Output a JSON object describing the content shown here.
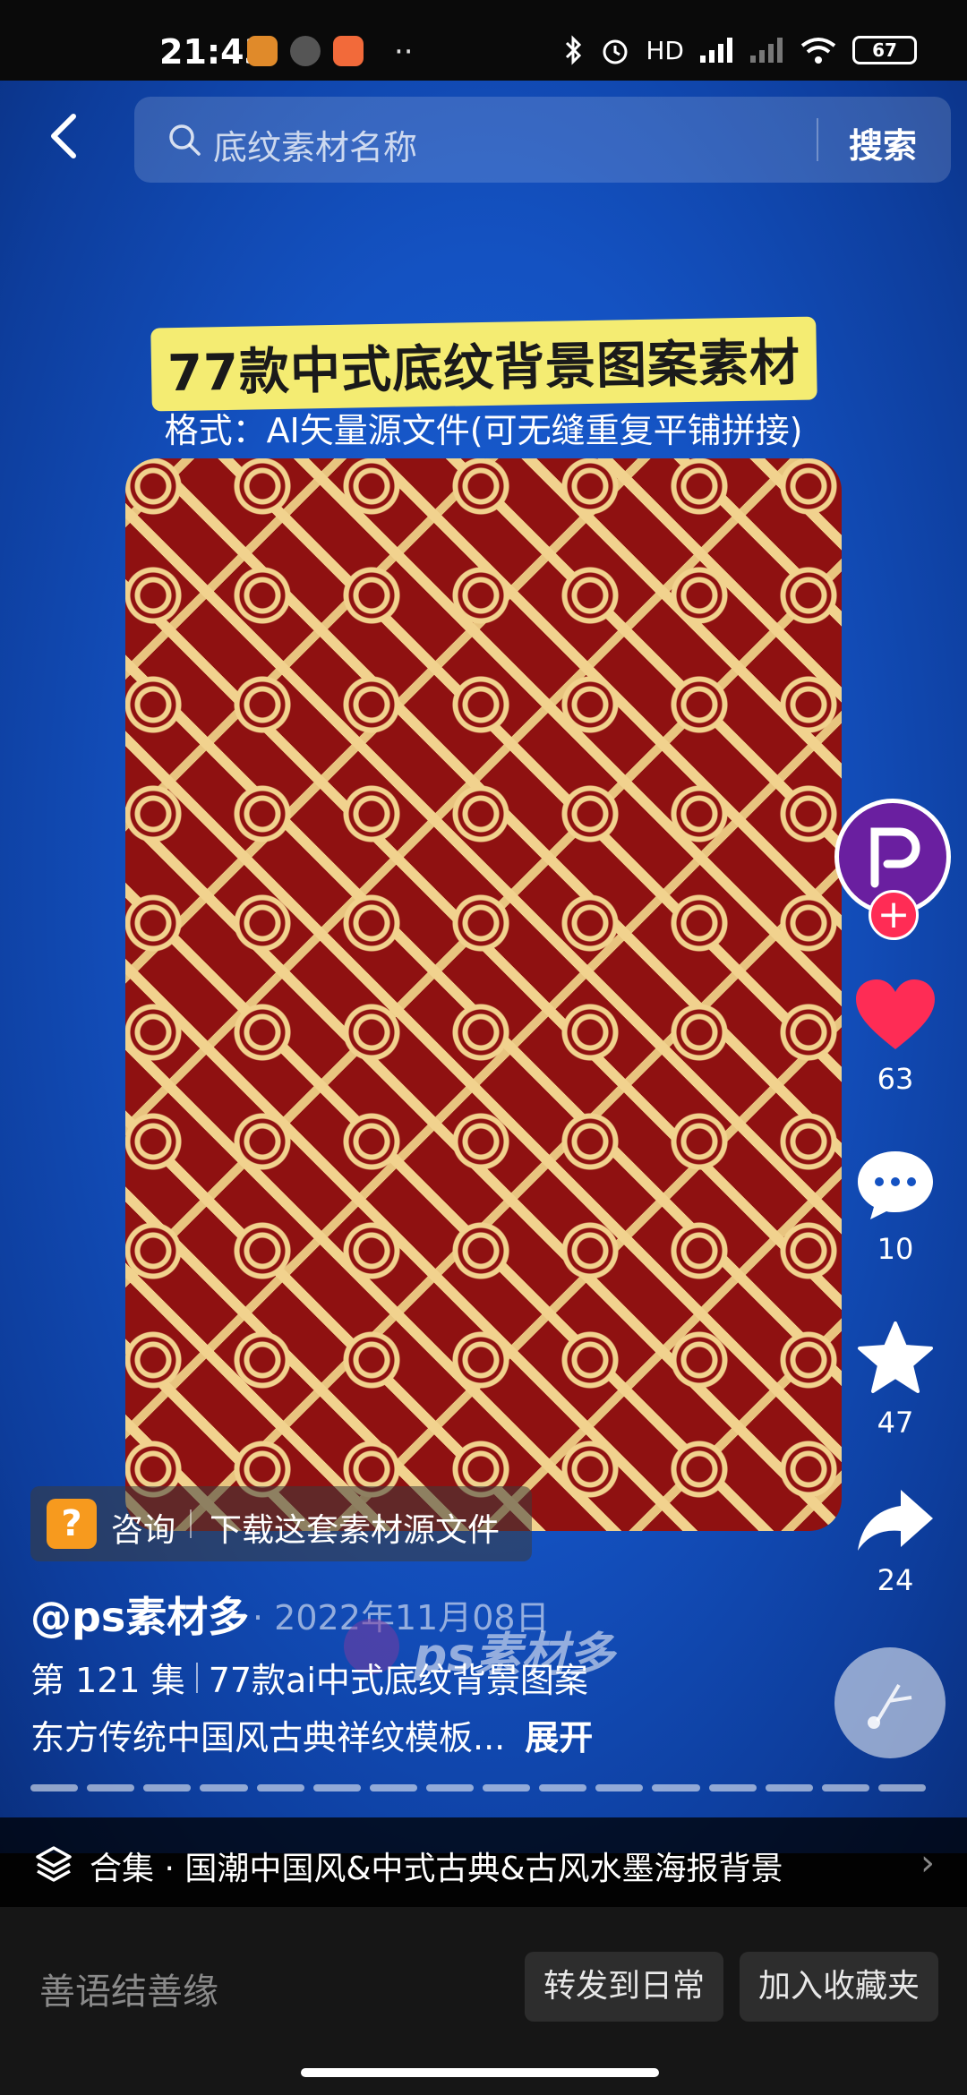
{
  "status_bar": {
    "time": "21:43",
    "dots": "··",
    "network_label": "HD",
    "battery": "67"
  },
  "search": {
    "placeholder": "底纹素材名称",
    "button": "搜索"
  },
  "video": {
    "title": "77款中式底纹背景图案素材",
    "subtitle": "格式：AI矢量源文件(可无缝重复平铺拼接)"
  },
  "actions": {
    "likes": "63",
    "comments": "10",
    "favorites": "47",
    "shares": "24"
  },
  "consult": {
    "label": "咨询",
    "text": "下载这套素材源文件"
  },
  "post": {
    "author": "@ps素材多",
    "date": "· 2022年11月08日",
    "watermark": "ps素材多",
    "episode": "第 121 集",
    "episode_title": "77款ai中式底纹背景图案",
    "description": "东方传统中国风古典祥纹模板...",
    "expand": "展开"
  },
  "collection": {
    "text": "合集 · 国潮中国风&中式古典&古风水墨海报背景"
  },
  "bottom": {
    "comment_placeholder": "善语结善缘",
    "forward_button": "转发到日常",
    "favorite_button": "加入收藏夹"
  },
  "colors": {
    "accent_red": "#ff2c55",
    "pattern_red": "#8f1111",
    "pattern_gold": "#f1d28e",
    "title_yellow": "#f4ec72"
  }
}
